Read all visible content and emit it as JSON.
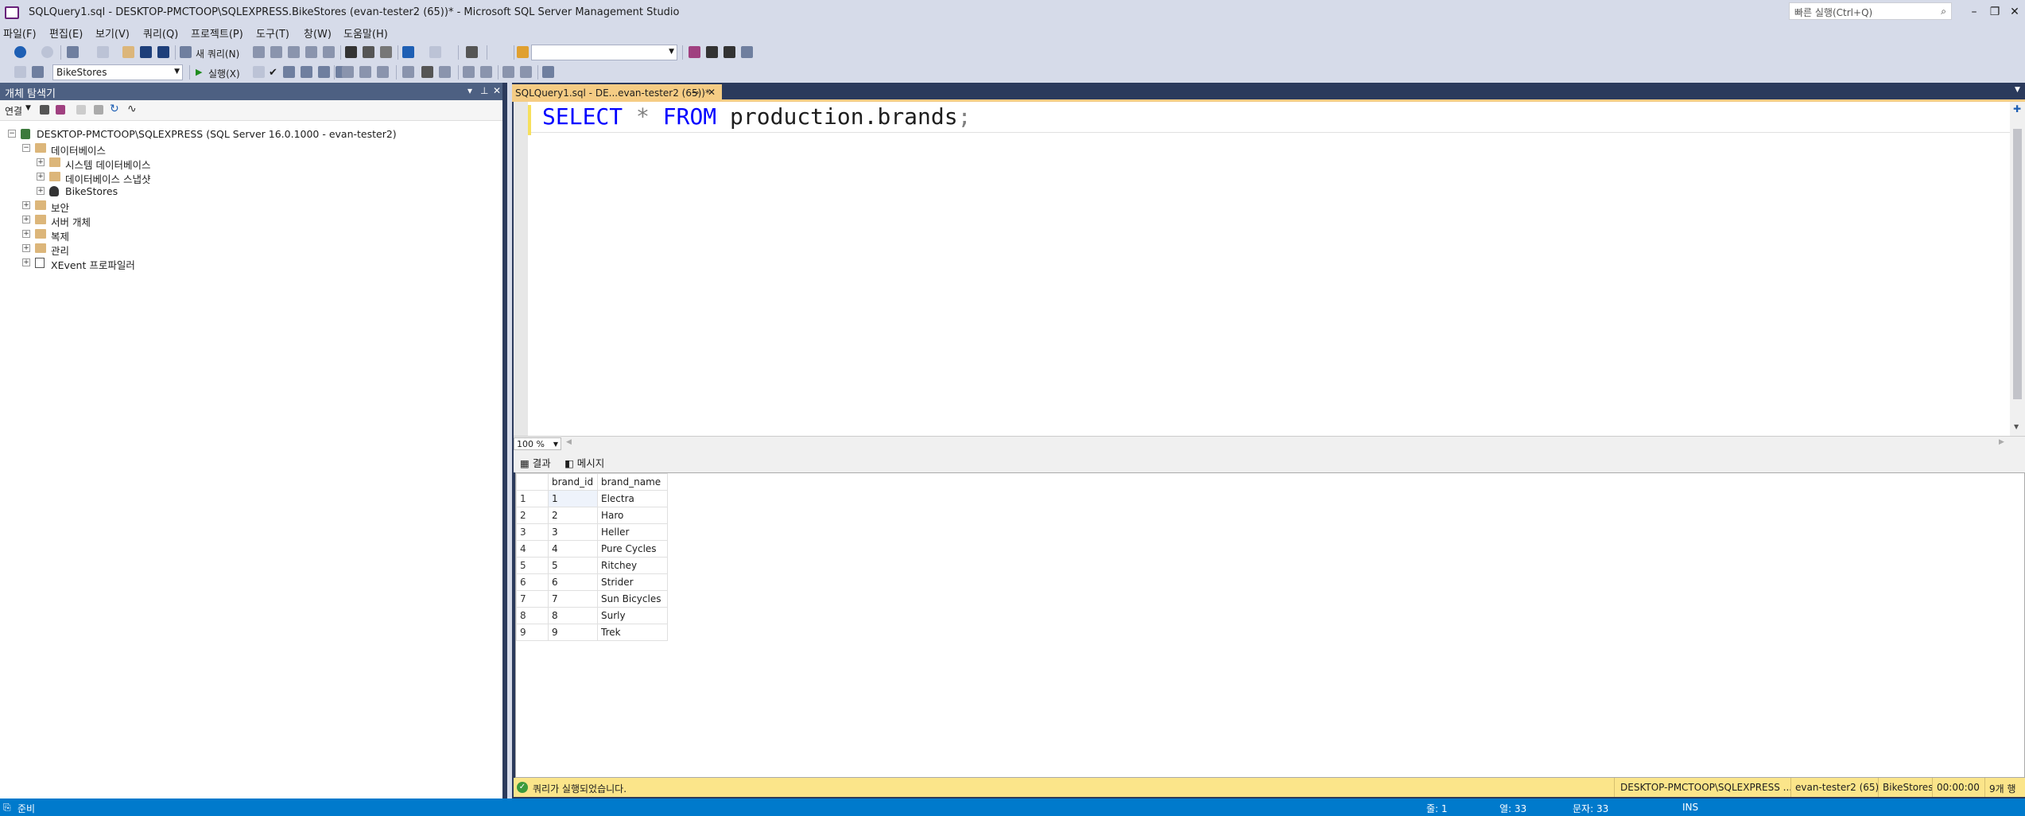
{
  "window": {
    "title": "SQLQuery1.sql - DESKTOP-PMCTOOP\\SQLEXPRESS.BikeStores (evan-tester2 (65))* - Microsoft SQL Server Management Studio",
    "quick_launch_placeholder": "빠른 실행(Ctrl+Q)"
  },
  "menu": [
    "파일(F)",
    "편집(E)",
    "보기(V)",
    "쿼리(Q)",
    "프로젝트(P)",
    "도구(T)",
    "창(W)",
    "도움말(H)"
  ],
  "toolbar": {
    "new_query_label": "새 쿼리(N)",
    "execute_label": "실행(X)",
    "database_selected": "BikeStores",
    "solution_config_value": ""
  },
  "object_explorer": {
    "title": "개체 탐색기",
    "connect_label": "연결",
    "tree": [
      {
        "label": "DESKTOP-PMCTOOP\\SQLEXPRESS (SQL Server 16.0.1000 - evan-tester2)",
        "expanded": true
      },
      {
        "label": "데이터베이스",
        "expanded": true
      },
      {
        "label": "시스템 데이터베이스",
        "expanded": false
      },
      {
        "label": "데이터베이스 스냅샷",
        "expanded": false
      },
      {
        "label": "BikeStores",
        "expanded": false
      },
      {
        "label": "보안",
        "expanded": false
      },
      {
        "label": "서버 개체",
        "expanded": false
      },
      {
        "label": "복제",
        "expanded": false
      },
      {
        "label": "관리",
        "expanded": false
      },
      {
        "label": "XEvent 프로파일러",
        "expanded": false
      }
    ]
  },
  "editor": {
    "tab_label": "SQLQuery1.sql - DE...evan-tester2 (65))*",
    "code": {
      "kw1": "SELECT",
      "star": "*",
      "kw2": "FROM",
      "rest": "production.brands",
      "semi": ";"
    },
    "zoom": "100 %"
  },
  "results": {
    "tabs": {
      "results": "결과",
      "messages": "메시지"
    },
    "columns": [
      "brand_id",
      "brand_name"
    ],
    "rows": [
      {
        "n": "1",
        "id": "1",
        "name": "Electra"
      },
      {
        "n": "2",
        "id": "2",
        "name": "Haro"
      },
      {
        "n": "3",
        "id": "3",
        "name": "Heller"
      },
      {
        "n": "4",
        "id": "4",
        "name": "Pure Cycles"
      },
      {
        "n": "5",
        "id": "5",
        "name": "Ritchey"
      },
      {
        "n": "6",
        "id": "6",
        "name": "Strider"
      },
      {
        "n": "7",
        "id": "7",
        "name": "Sun Bicycles"
      },
      {
        "n": "8",
        "id": "8",
        "name": "Surly"
      },
      {
        "n": "9",
        "id": "9",
        "name": "Trek"
      }
    ]
  },
  "query_status": {
    "message": "쿼리가 실행되었습니다.",
    "server": "DESKTOP-PMCTOOP\\SQLEXPRESS ...",
    "user": "evan-tester2 (65)",
    "database": "BikeStores",
    "elapsed": "00:00:00",
    "rows": "9개 행"
  },
  "statusbar": {
    "ready": "준비",
    "line": "줄: 1",
    "col": "열: 33",
    "ch": "문자: 33",
    "mode": "INS"
  },
  "colors": {
    "accent": "#007acc",
    "tab": "#f5cc84",
    "status": "#fbe58a"
  }
}
